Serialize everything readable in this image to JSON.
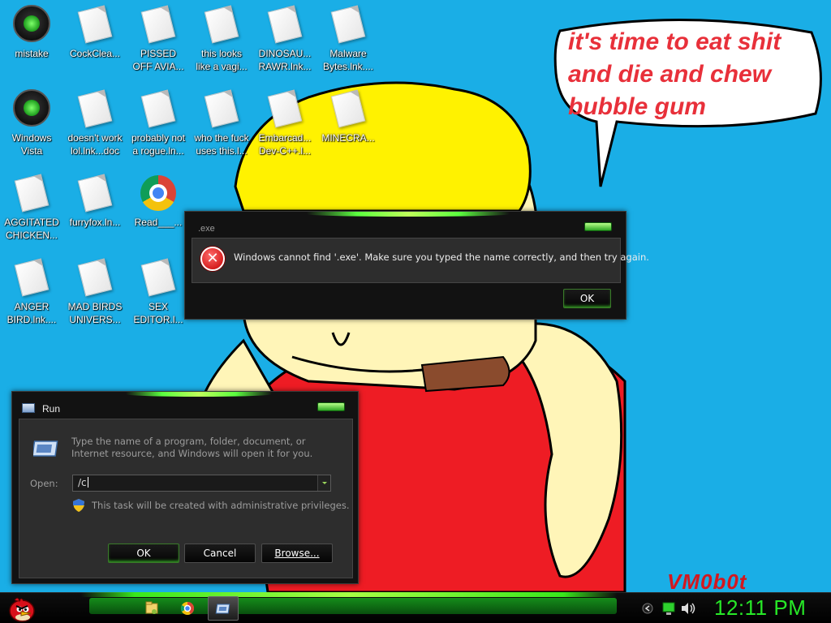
{
  "wallpaper": {
    "speech_bubble_text": "it's time to eat shit\nand die and chew\nbubble gum",
    "watermark": "VM0b0t"
  },
  "desktop_icons": [
    {
      "label": "mistake",
      "icon": "green-ball-icon"
    },
    {
      "label": "CockClea...",
      "icon": "shortcut-file-icon"
    },
    {
      "label": "PISSED\nOFF AVIA...",
      "icon": "shortcut-file-icon"
    },
    {
      "label": "this looks\nlike a vagi...",
      "icon": "shortcut-file-icon"
    },
    {
      "label": "DINOSAU...\nRAWR.lnk...",
      "icon": "shortcut-file-icon"
    },
    {
      "label": "Malware\nBytes.lnk....",
      "icon": "shortcut-file-icon"
    },
    {
      "label": "Windows\nVista",
      "icon": "recycle-bin-icon"
    },
    {
      "label": "doesn't work\nlol.lnk...doc",
      "icon": "shortcut-file-icon"
    },
    {
      "label": "probably not\na rogue.ln...",
      "icon": "shortcut-file-icon"
    },
    {
      "label": "who the fuck\nuses this.l...",
      "icon": "shortcut-file-icon"
    },
    {
      "label": "Embarcad...\nDev-C++.l...",
      "icon": "shortcut-file-icon"
    },
    {
      "label": "MINECRA...",
      "icon": "shortcut-file-icon"
    },
    {
      "label": "AGGITATED\nCHICKEN...",
      "icon": "shortcut-file-icon"
    },
    {
      "label": "furryfox.ln...",
      "icon": "shortcut-file-icon"
    },
    {
      "label": "Read___...",
      "icon": "chrome-icon"
    },
    {
      "label": "ANGER\nBIRD.lnk....",
      "icon": "shortcut-file-icon"
    },
    {
      "label": "MAD BIRDS\nUNIVERS...",
      "icon": "shortcut-file-icon"
    },
    {
      "label": "SEX\nEDITOR.l...",
      "icon": "shortcut-file-icon"
    }
  ],
  "error_dialog": {
    "title": ".exe",
    "message": "Windows cannot find '.exe'. Make sure you typed the name correctly, and then try again.",
    "ok_label": "OK"
  },
  "run_dialog": {
    "title": "Run",
    "description": "Type the name of a program, folder, document, or Internet resource, and Windows will open it for you.",
    "open_label": "Open:",
    "open_value": "/c",
    "admin_note": "This task will be created with administrative privileges.",
    "ok_label": "OK",
    "cancel_label": "Cancel",
    "browse_label": "Browse..."
  },
  "taskbar": {
    "start_icon": "angry-bird-icon",
    "pinned": [
      "explorer-icon",
      "chrome-icon",
      "run-icon"
    ],
    "tray_icons": [
      "chevron-icon",
      "network-icon",
      "volume-icon"
    ],
    "clock": "12:11 PM"
  }
}
